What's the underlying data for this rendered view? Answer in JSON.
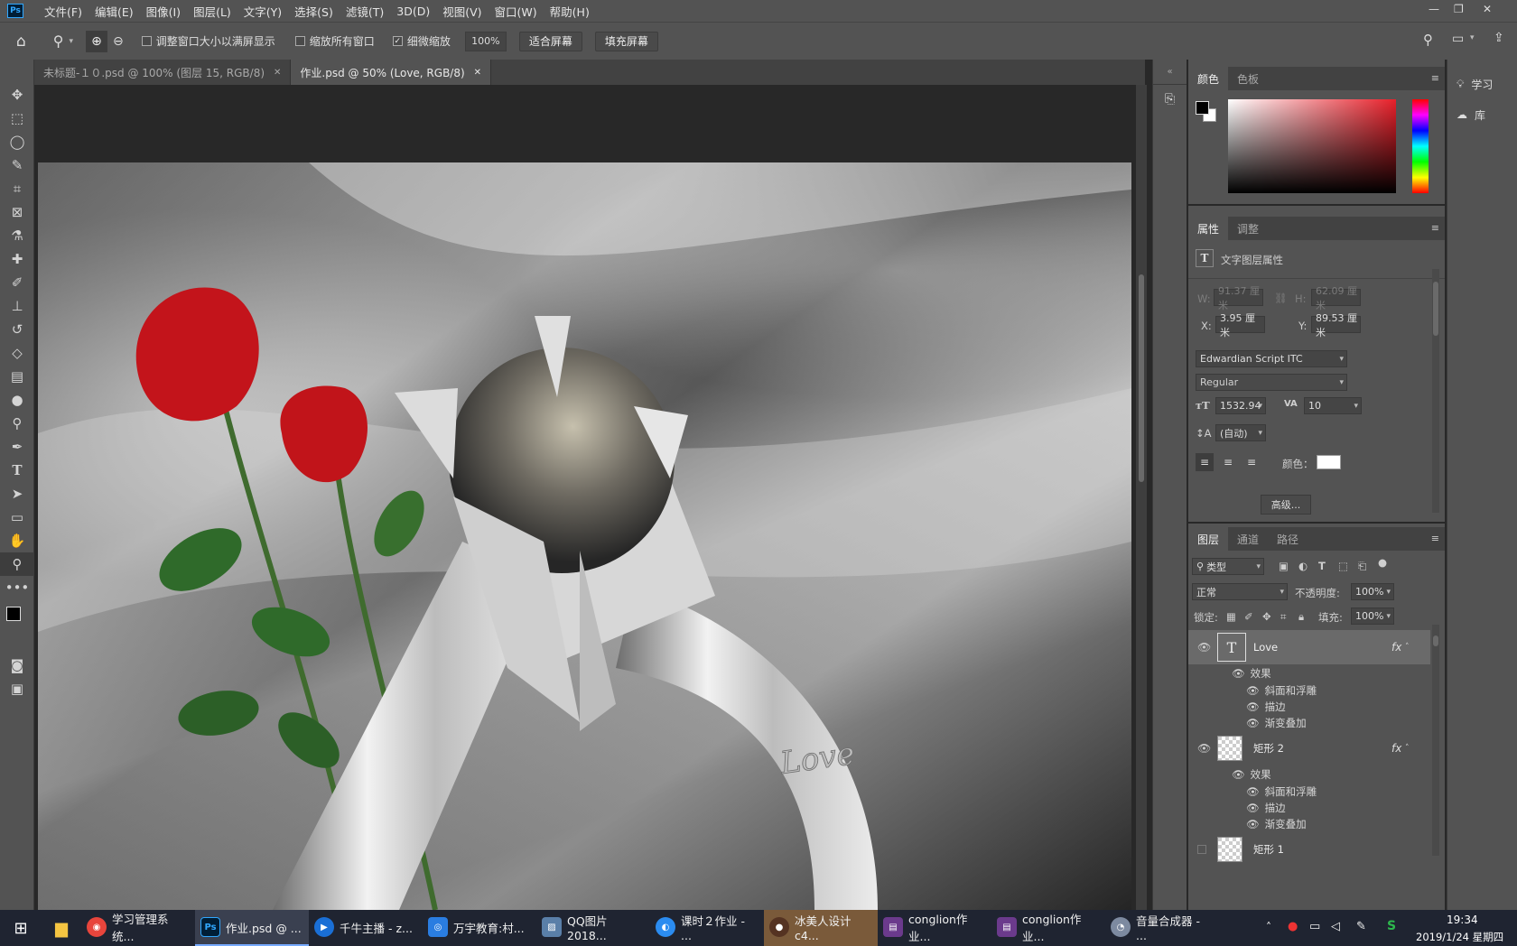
{
  "menubar": {
    "logo": "Ps",
    "items": [
      "文件(F)",
      "编辑(E)",
      "图像(I)",
      "图层(L)",
      "文字(Y)",
      "选择(S)",
      "滤镜(T)",
      "3D(D)",
      "视图(V)",
      "窗口(W)",
      "帮助(H)"
    ]
  },
  "options": {
    "resize_windows": "调整窗口大小以满屏显示",
    "zoom_all": "缩放所有窗口",
    "scrubby_zoom": "细微缩放",
    "zoom_value": "100%",
    "fit_screen": "适合屏幕",
    "fill_screen": "填充屏幕"
  },
  "tabs": [
    {
      "label": "未标题-１０.psd @ 100% (图层 15, RGB/8)"
    },
    {
      "label": "作业.psd @ 50% (Love, RGB/8)"
    }
  ],
  "canvas": {
    "engraving": "Love"
  },
  "color_panel": {
    "tabs": [
      "颜色",
      "色板"
    ]
  },
  "properties": {
    "tabs": [
      "属性",
      "调整"
    ],
    "title": "文字图层属性",
    "w_label": "W:",
    "w_value": "91.37 厘米",
    "h_label": "H:",
    "h_value": "62.09 厘米",
    "x_label": "X:",
    "x_value": "3.95 厘米",
    "y_label": "Y:",
    "y_value": "89.53 厘米",
    "font": "Edwardian Script ITC",
    "style": "Regular",
    "size": "1532.94",
    "tracking": "10",
    "leading": "(自动)",
    "color_label": "颜色：",
    "advanced": "高级..."
  },
  "layers": {
    "tabs": [
      "图层",
      "通道",
      "路径"
    ],
    "filter": "类型",
    "blend": "正常",
    "opacity_label": "不透明度:",
    "opacity": "100%",
    "lock_label": "锁定:",
    "fill_label": "填充:",
    "fill": "100%",
    "effects_label": "效果",
    "fx_label": "fx",
    "items": [
      {
        "name": "Love",
        "effects": [
          "斜面和浮雕",
          "描边",
          "渐变叠加"
        ]
      },
      {
        "name": "矩形 2",
        "effects": [
          "斜面和浮雕",
          "描边",
          "渐变叠加"
        ]
      },
      {
        "name": "矩形 1"
      }
    ]
  },
  "far_right": {
    "learn": "学习",
    "library": "库"
  },
  "taskbar": {
    "items": [
      {
        "label": "学习管理系统...",
        "color": "#e8453c"
      },
      {
        "label": "作业.psd @ ...",
        "color": "#001e36"
      },
      {
        "label": "千牛主播 - z...",
        "color": "#1a6fd6"
      },
      {
        "label": "万宇教育:村...",
        "color": "#2a7de1"
      },
      {
        "label": "QQ图片2018...",
        "color": "#5a7fa8"
      },
      {
        "label": "课时２作业 - ...",
        "color": "#2b8cf0"
      },
      {
        "label": "冰美人设计c4...",
        "color": "#553322"
      },
      {
        "label": "conglion作业...",
        "color": "#6b3a8c"
      },
      {
        "label": "conglion作业...",
        "color": "#6b3a8c"
      },
      {
        "label": "音量合成器 - ...",
        "color": "#7d8aa0"
      }
    ],
    "time": "19:34",
    "date": "2019/1/24 星期四"
  }
}
